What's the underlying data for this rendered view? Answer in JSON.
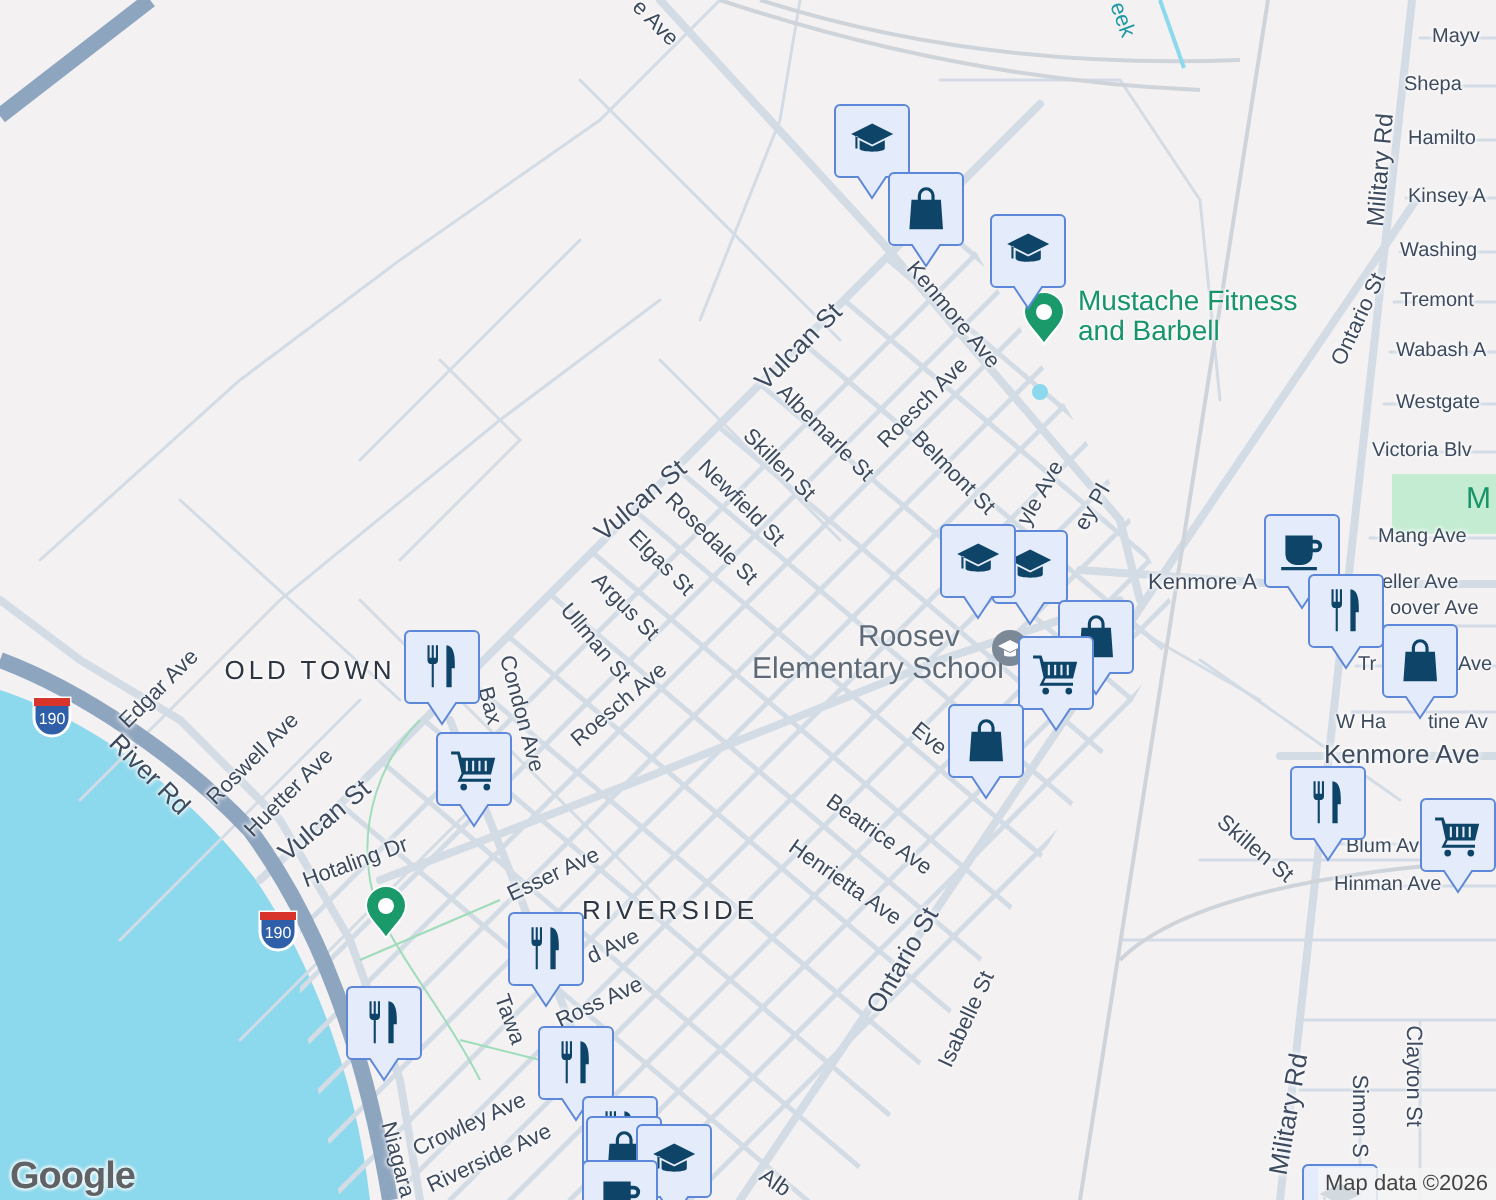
{
  "map": {
    "streets": [
      {
        "name": "e Ave"
      },
      {
        "name": "Kenmore Ave"
      },
      {
        "name": "Vulcan St"
      },
      {
        "name": "Albemarle St"
      },
      {
        "name": "Roesch Ave"
      },
      {
        "name": "Belmont St"
      },
      {
        "name": "yle Ave"
      },
      {
        "name": "ey Pl"
      },
      {
        "name": "Skillen St"
      },
      {
        "name": "Newfield St"
      },
      {
        "name": "Rosedale St"
      },
      {
        "name": "Vulcan St"
      },
      {
        "name": "Elgas St"
      },
      {
        "name": "Argus St"
      },
      {
        "name": "Ullman St"
      },
      {
        "name": "Roesch Ave"
      },
      {
        "name": "Condon Ave"
      },
      {
        "name": "Bax"
      },
      {
        "name": "Edgar Ave"
      },
      {
        "name": "River Rd"
      },
      {
        "name": "Roswell Ave"
      },
      {
        "name": "Huetter Ave"
      },
      {
        "name": "Vulcan St"
      },
      {
        "name": "Hotaling Dr"
      },
      {
        "name": "Esser Ave"
      },
      {
        "name": "d Ave"
      },
      {
        "name": "Tawa"
      },
      {
        "name": "Ross Ave"
      },
      {
        "name": "Crowley Ave"
      },
      {
        "name": "Riverside Ave"
      },
      {
        "name": "Niagara"
      },
      {
        "name": "Eve"
      },
      {
        "name": "Beatrice Ave"
      },
      {
        "name": "Henrietta Ave"
      },
      {
        "name": "Ontario St"
      },
      {
        "name": "Isabelle St"
      },
      {
        "name": "Alb"
      },
      {
        "name": "Kenmore A"
      },
      {
        "name": "Skillen St"
      },
      {
        "name": "Ontario St"
      },
      {
        "name": "Military Rd"
      },
      {
        "name": "Military Rd"
      },
      {
        "name": "Simon S"
      },
      {
        "name": "Clayton St"
      },
      {
        "name": "Mayv"
      },
      {
        "name": "Shepa"
      },
      {
        "name": "Hamilto"
      },
      {
        "name": "Kinsey A"
      },
      {
        "name": "Washing"
      },
      {
        "name": "Tremont"
      },
      {
        "name": "Wabash A"
      },
      {
        "name": "Westgate"
      },
      {
        "name": "Victoria Blv"
      },
      {
        "name": "Mang Ave"
      },
      {
        "name": "eller Ave"
      },
      {
        "name": "oover Ave"
      },
      {
        "name": "Tr"
      },
      {
        "name": "Ave"
      },
      {
        "name": "W Ha"
      },
      {
        "name": "tine Av"
      },
      {
        "name": "Kenmore Ave"
      },
      {
        "name": "Blum Av"
      },
      {
        "name": "Hinman Ave"
      }
    ],
    "areas": [
      "OLD TOWN",
      "RIVERSIDE"
    ],
    "creek": "eek",
    "park_label": "M",
    "places": [
      {
        "name": "Mustache Fitness and Barbell"
      }
    ],
    "school_label": [
      "Roosev",
      "Elementary School"
    ],
    "highway_shields": [
      "190",
      "190"
    ],
    "markers": [
      {
        "kind": "education"
      },
      {
        "kind": "shopping"
      },
      {
        "kind": "education"
      },
      {
        "kind": "education"
      },
      {
        "kind": "education"
      },
      {
        "kind": "shopping"
      },
      {
        "kind": "grocery"
      },
      {
        "kind": "shopping"
      },
      {
        "kind": "cafe"
      },
      {
        "kind": "restaurant"
      },
      {
        "kind": "shopping"
      },
      {
        "kind": "restaurant"
      },
      {
        "kind": "grocery"
      },
      {
        "kind": "restaurant"
      },
      {
        "kind": "grocery"
      },
      {
        "kind": "restaurant"
      },
      {
        "kind": "restaurant"
      },
      {
        "kind": "restaurant"
      },
      {
        "kind": "restaurant"
      },
      {
        "kind": "shopping"
      },
      {
        "kind": "education"
      },
      {
        "kind": "cafe"
      },
      {
        "kind": "education"
      }
    ]
  },
  "attribution": {
    "logo": "Google",
    "text": "Map data ©2026"
  }
}
